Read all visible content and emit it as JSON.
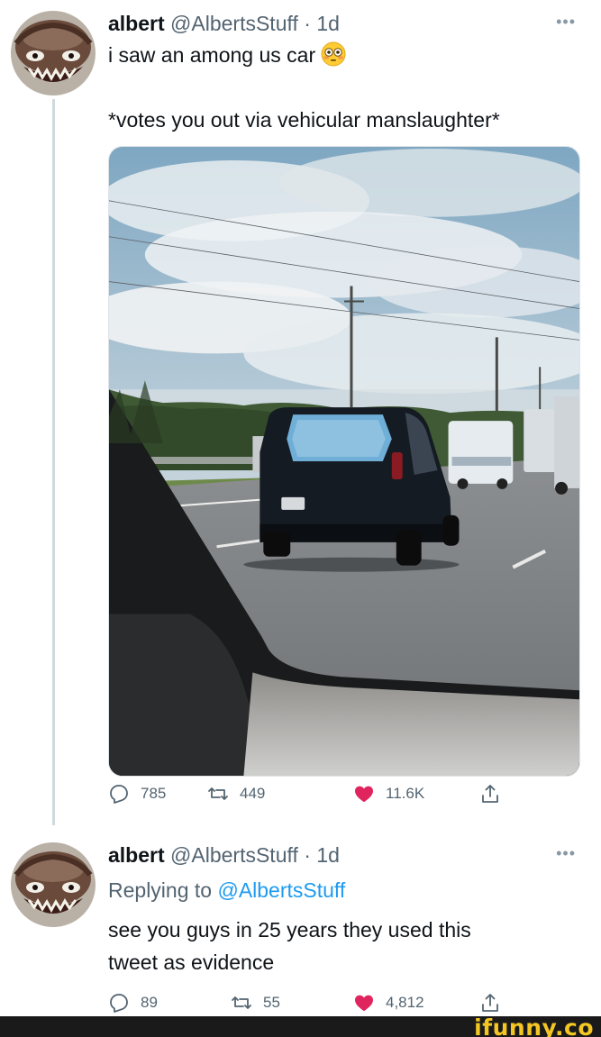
{
  "tweet1": {
    "name": "albert",
    "handle": "@AlbertsStuff",
    "time_sep": " · ",
    "time": "1d",
    "more": "•••",
    "line1": "i saw an among us car",
    "line1_emoji": "flushed-face-emoji",
    "line2": "*votes you out via vehicular manslaughter*",
    "media": "photo-dashboard-view-of-van-on-highway",
    "replies": "785",
    "retweets": "449",
    "likes": "11.6K",
    "like_color": "#e0245e"
  },
  "tweet2": {
    "name": "albert",
    "handle": "@AlbertsStuff",
    "time_sep": " · ",
    "time": "1d",
    "more": "•••",
    "replying_prefix": "Replying to ",
    "replying_mention": "@AlbertsStuff",
    "line1": "see you guys in 25 years they used this",
    "line2": "tweet as evidence",
    "replies": "89",
    "retweets": "55",
    "likes": "4,812"
  },
  "icons": [
    "reply-icon",
    "retweet-icon",
    "like-icon",
    "share-icon"
  ],
  "colors": {
    "text": "#0f1419",
    "secondary": "#536471",
    "link": "#1d9bf0",
    "like": "#e0245e",
    "watermark": "#f3c623"
  },
  "watermark": "ifunny.co"
}
